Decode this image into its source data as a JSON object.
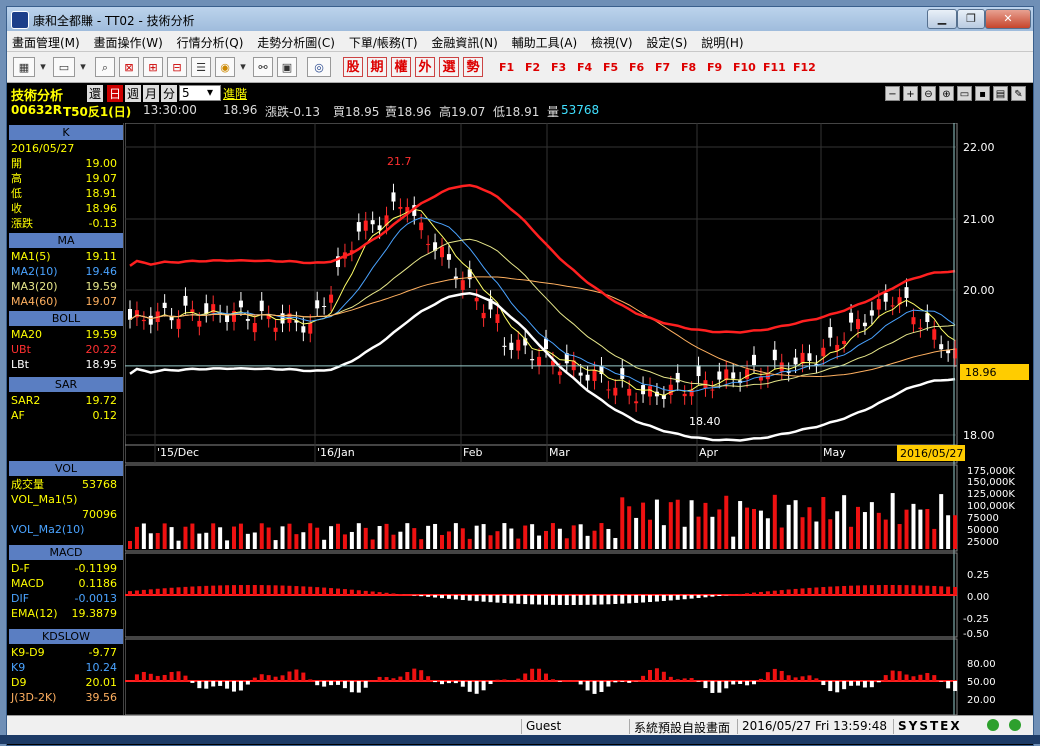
{
  "window": {
    "title": "康和全都賺 - TT02 - 技術分析"
  },
  "menu": [
    "畫面管理(M)",
    "畫面操作(W)",
    "行情分析(Q)",
    "走勢分析圖(C)",
    "下單/帳務(T)",
    "金融資訊(N)",
    "輔助工具(A)",
    "檢視(V)",
    "設定(S)",
    "說明(H)"
  ],
  "toolbar": {
    "quick_buttons": [
      "股",
      "期",
      "權",
      "外",
      "選",
      "勢"
    ],
    "function_keys": [
      "F1",
      "F2",
      "F3",
      "F4",
      "F5",
      "F6",
      "F7",
      "F8",
      "F9",
      "F10",
      "F11",
      "F12"
    ]
  },
  "info": {
    "label": "技術分析",
    "btn_back": "還",
    "period_day": "日",
    "period_week": "週",
    "period_month": "月",
    "period_minute": "分",
    "period_select": "5",
    "advanced": "進階",
    "code": "00632R",
    "name": "T50反1(日)",
    "time": "13:30:00",
    "price": "18.96",
    "change": "漲跌-0.13",
    "bid": "買18.95",
    "ask": "賣18.96",
    "high": "高19.07",
    "low": "低18.91",
    "volume_label": "量",
    "volume": "53768"
  },
  "sidebar": {
    "k": {
      "title": "K",
      "date": "2016/05/27",
      "rows": [
        {
          "label": "開",
          "value": "19.00"
        },
        {
          "label": "高",
          "value": "19.07"
        },
        {
          "label": "低",
          "value": "18.91"
        },
        {
          "label": "收",
          "value": "18.96"
        },
        {
          "label": "漲跌",
          "value": "-0.13"
        }
      ]
    },
    "ma": {
      "title": "MA",
      "rows": [
        {
          "label": "MA1(5)",
          "value": "19.11",
          "color": "#ffff00"
        },
        {
          "label": "MA2(10)",
          "value": "19.46",
          "color": "#4aa3ff"
        },
        {
          "label": "MA3(20)",
          "value": "19.59",
          "color": "#e6e68a"
        },
        {
          "label": "MA4(60)",
          "value": "19.07",
          "color": "#ffb060"
        }
      ]
    },
    "boll": {
      "title": "BOLL",
      "rows": [
        {
          "label": "MA20",
          "value": "19.59",
          "color": "#ffff00"
        },
        {
          "label": "UBt",
          "value": "20.22",
          "color": "#ff3030"
        },
        {
          "label": "LBt",
          "value": "18.95",
          "color": "#ffffff"
        }
      ]
    },
    "sar": {
      "title": "SAR",
      "rows": [
        {
          "label": "SAR2",
          "value": "19.72",
          "color": "#ffff00"
        },
        {
          "label": "AF",
          "value": "0.12",
          "color": "#ffff00"
        }
      ]
    },
    "vol": {
      "title": "VOL",
      "rows": [
        {
          "label": "成交量",
          "value": "53768",
          "color": "#ffff00"
        },
        {
          "label": "VOL_Ma1(5)",
          "value": "",
          "color": "#ffff00"
        },
        {
          "label": "",
          "value": "70096",
          "color": "#ffff00"
        },
        {
          "label": "VOL_Ma2(10)",
          "value": "",
          "color": "#4aa3ff"
        }
      ]
    },
    "macd": {
      "title": "MACD",
      "rows": [
        {
          "label": "D-F",
          "value": "-0.1199",
          "color": "#ffff00"
        },
        {
          "label": "MACD",
          "value": "0.1186",
          "color": "#ffff00"
        },
        {
          "label": "DIF",
          "value": "-0.0013",
          "color": "#4aa3ff"
        },
        {
          "label": "EMA(12)",
          "value": "19.3879",
          "color": "#ffff00"
        }
      ]
    },
    "kd": {
      "title": "KDSLOW",
      "rows": [
        {
          "label": "K9-D9",
          "value": "-9.77",
          "color": "#ffff00"
        },
        {
          "label": "K9",
          "value": "10.24",
          "color": "#4aa3ff"
        },
        {
          "label": "D9",
          "value": "20.01",
          "color": "#ffff00"
        },
        {
          "label": "J(3D-2K)",
          "value": "39.56",
          "color": "#ffb060"
        }
      ]
    }
  },
  "chart": {
    "price_ticks": [
      "22.00",
      "21.00",
      "20.00",
      "18.00"
    ],
    "price_tag": "18.96",
    "date_tag": "2016/05/27",
    "months": [
      "'15/Dec",
      "'16/Jan",
      "Feb",
      "Mar",
      "Apr",
      "May"
    ],
    "high_label": "21.7",
    "low_label": "18.40",
    "vol_ticks": [
      "175,000K",
      "150,000K",
      "125,000K",
      "100,000K",
      "75000",
      "50000",
      "25000"
    ],
    "macd_ticks": [
      "0.25",
      "0.00",
      "-0.25",
      "-0.50"
    ],
    "kd_ticks": [
      "80.00",
      "50.00",
      "20.00"
    ]
  },
  "status": {
    "user": "Guest",
    "screen": "系統預設自設畫面",
    "datetime": "2016/05/27 Fri 13:59:48",
    "brand": "SYSTEX"
  }
}
